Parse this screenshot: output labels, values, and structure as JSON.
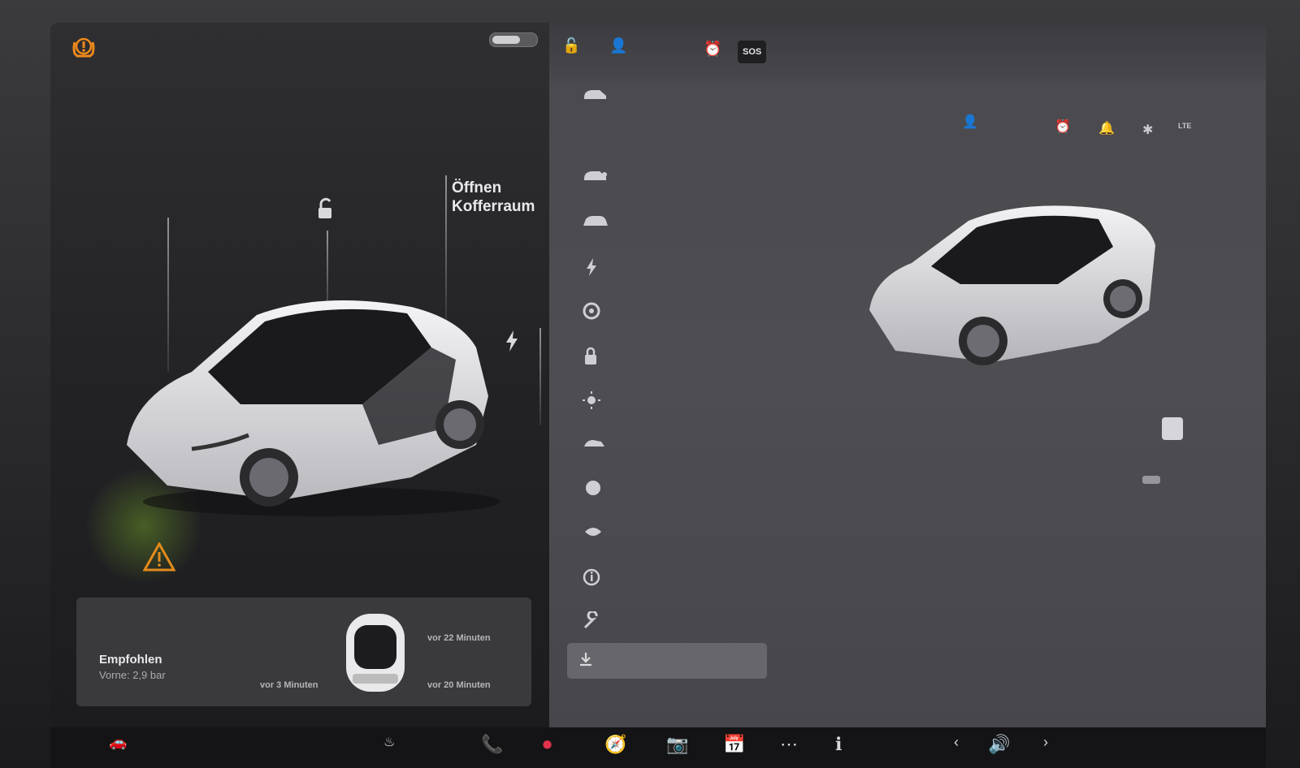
{
  "left_panel": {
    "trunk_label_line1": "Öffnen",
    "trunk_label_line2": "Kofferraum",
    "tire_card": {
      "title": "Empfohlen",
      "subtitle": "Vorne: 2,9 bar",
      "front_left_time": "vor 3 Minuten",
      "front_right_time": "vor 22 Minuten",
      "rear_right_time": "vor 20 Minuten"
    }
  },
  "topbar": {
    "sos_label": "SOS"
  },
  "status_bar": {
    "lte_label": "LTE"
  },
  "colors": {
    "warning_orange": "#f08a1a",
    "panel_dark": "#222225",
    "panel_gray": "#4a4a4e"
  },
  "icons": {
    "tire_pressure": "tire-pressure-warning-icon",
    "alarm": "alarm-clock-icon",
    "bell": "bell-icon",
    "bluetooth": "bluetooth-icon"
  }
}
